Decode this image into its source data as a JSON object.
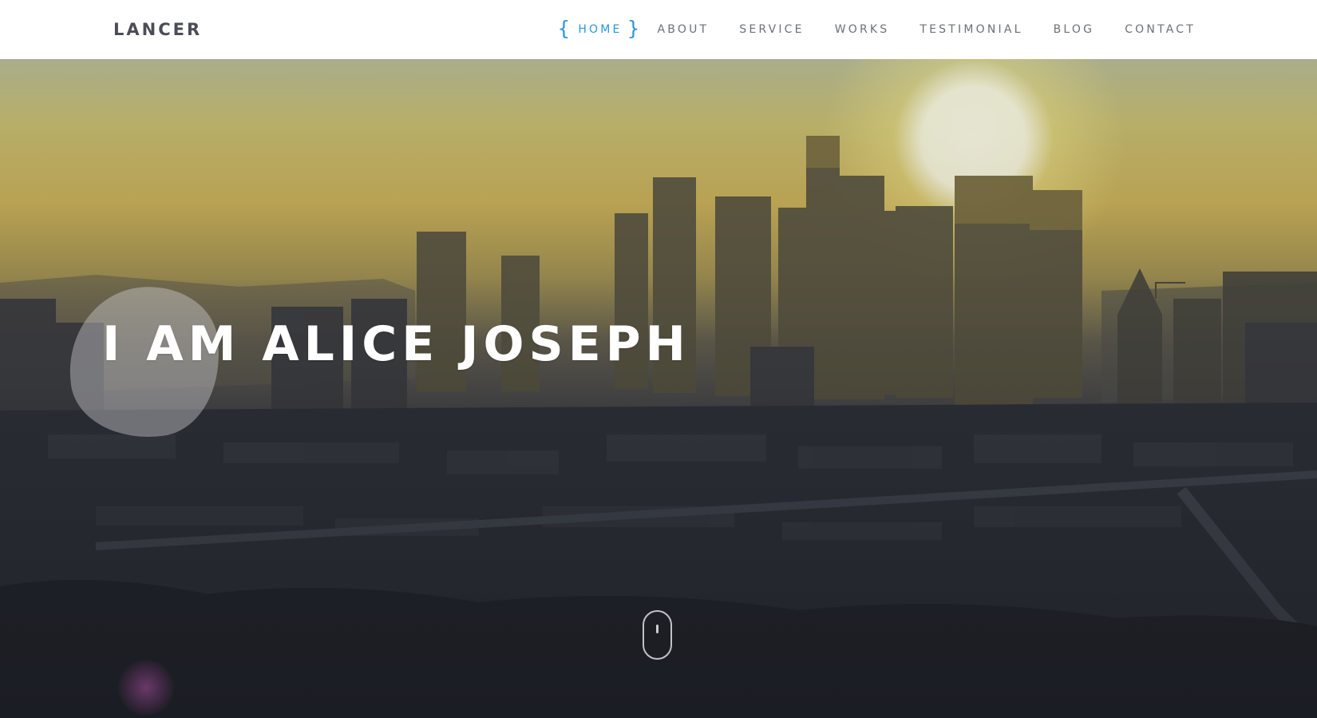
{
  "header": {
    "logo": "LANCER"
  },
  "nav": {
    "items": [
      {
        "label": "HOME",
        "active": true
      },
      {
        "label": "ABOUT",
        "active": false
      },
      {
        "label": "SERVICE",
        "active": false
      },
      {
        "label": "WORKS",
        "active": false
      },
      {
        "label": "TESTIMONIAL",
        "active": false
      },
      {
        "label": "BLOG",
        "active": false
      },
      {
        "label": "CONTACT",
        "active": false
      }
    ],
    "active_brace_left": "{",
    "active_brace_right": "}"
  },
  "hero": {
    "title": "I AM ALICE JOSEPH",
    "background": "city-skyline-at-sunset",
    "scroll_indicator_icon": "mouse-scroll-icon"
  },
  "colors": {
    "accent": "#2a97d8",
    "nav_text": "#6d7078",
    "logo": "#4a4d56",
    "hero_title": "#ffffff"
  }
}
